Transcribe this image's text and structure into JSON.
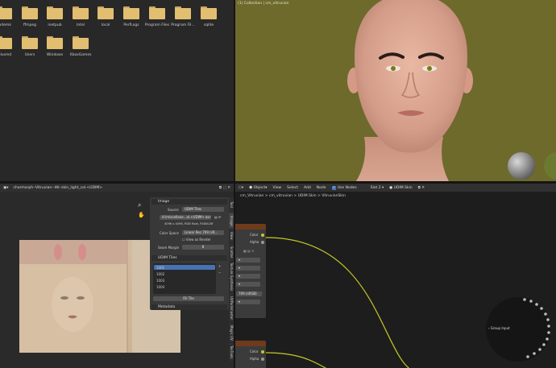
{
  "file_browser": {
    "row1": [
      "codemk",
      "ffmpeg",
      "inetpub",
      "Intel",
      "local",
      "PerfLogs",
      "Program Files",
      "Program Fil...",
      "sqlite"
    ],
    "row2": [
      "rplusmd",
      "Users",
      "Windows",
      "XboxGames"
    ]
  },
  "viewport": {
    "info": "(1) Collection | cm_vitruvian"
  },
  "node_header": {
    "mode": "Object",
    "menus": [
      "View",
      "Select",
      "Add",
      "Node"
    ],
    "use_nodes_label": "Use Nodes",
    "slot": "Slot 2",
    "material": "UDIM.Skin",
    "breadcrumbs": [
      "cm_Vitruvian",
      "cm_vitruvian",
      "UDIM.Skin",
      "VitruvianSkin"
    ]
  },
  "image_editor": {
    "image_name": "charmorph--Vitruvian--4K--skin_light_col.<UDIM>",
    "panel": {
      "image_title": "Image",
      "source_label": "Source",
      "source_value": "UDIM Tiles",
      "filepath": "d:\\miscellane...ol.<UDIM>.exr",
      "info": "4096 x 4096, RGB float, RGBA16f",
      "color_space_label": "Color Space",
      "color_space_value": "Linear Rec.709 (sR...",
      "view_as_render": "View as Render",
      "seam_margin_label": "Seam Margin",
      "seam_margin_value": "8",
      "udim_title": "UDIM Tiles",
      "tiles": [
        "1001",
        "1002",
        "1003",
        "1004"
      ],
      "fill_tile": "Fill Tile",
      "metadata_title": "Metadata"
    },
    "tabs": [
      "Tool",
      "Image",
      "View",
      "Scatter",
      "Texture Synthesis",
      "UVPackmaster",
      "Magic UV",
      "TexTools"
    ]
  },
  "nodes": {
    "texture_node_1": {
      "color": "Color",
      "alpha": "Alpha",
      "colorspace": "709 (sRGB)"
    },
    "texture_node_2": {
      "color": "Color",
      "alpha": "Alpha"
    },
    "group_input": "Group Input"
  },
  "colors": {
    "viewport_bg": "#6d6a2c",
    "folder": "#e2be71",
    "color_socket": "#c7c729",
    "node_header": "#6e3b1c"
  }
}
